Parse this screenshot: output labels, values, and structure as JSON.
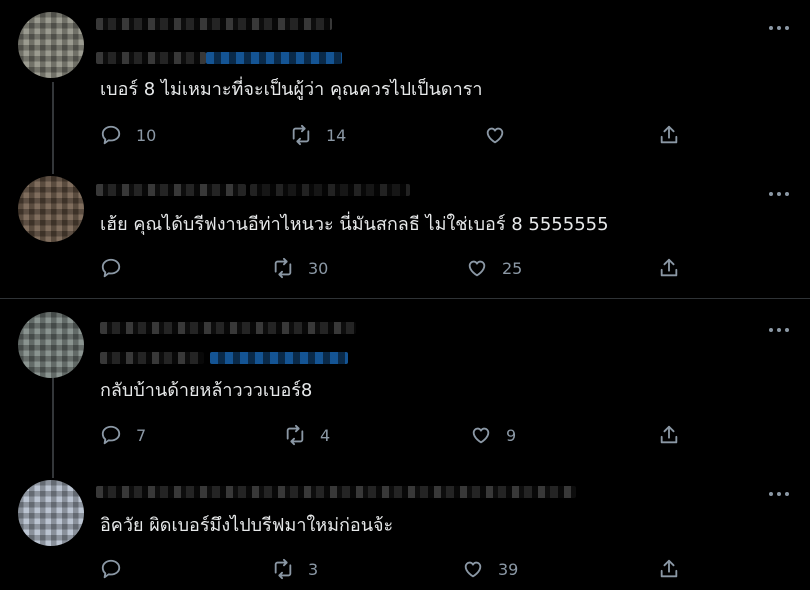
{
  "tweets": [
    {
      "text": "เบอร์ 8 ไม่เหมาะที่จะเป็นผู้ว่า คุณควรไปเป็นดารา",
      "replies": "10",
      "retweets": "14",
      "likes": ""
    },
    {
      "text": "เฮ้ย คุณได้บรีฟงานอีท่าไหนวะ นี่มันสกลธี ไม่ใช่เบอร์ 8 5555555",
      "replies": "",
      "retweets": "30",
      "likes": "25"
    },
    {
      "text": "กลับบ้านด้ายหล้าวววเบอร์8",
      "replies": "7",
      "retweets": "4",
      "likes": "9"
    },
    {
      "text": "อิควัย ผิดเบอร์มึงไปบรีฟมาใหม่ก่อนจ้ะ",
      "replies": "",
      "retweets": "3",
      "likes": "39"
    }
  ],
  "icons": {
    "reply": "reply-icon",
    "retweet": "retweet-icon",
    "like": "heart-icon",
    "share": "share-icon",
    "more": "more-options-icon"
  },
  "colors": {
    "background": "#000000",
    "text": "#e7e9ea",
    "muted": "#8b98a5",
    "divider": "#2f3336"
  }
}
